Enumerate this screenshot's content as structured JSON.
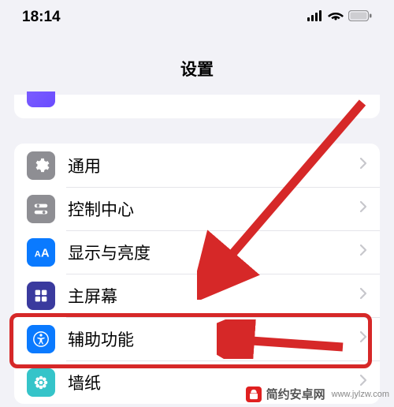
{
  "status": {
    "time": "18:14"
  },
  "header": {
    "title": "设置"
  },
  "settings": {
    "items": [
      {
        "label": "通用"
      },
      {
        "label": "控制中心"
      },
      {
        "label": "显示与亮度"
      },
      {
        "label": "主屏幕"
      },
      {
        "label": "辅助功能"
      },
      {
        "label": "墙纸"
      }
    ]
  },
  "watermark": {
    "brand": "简约安卓网",
    "url": "www.jylzw.com"
  }
}
